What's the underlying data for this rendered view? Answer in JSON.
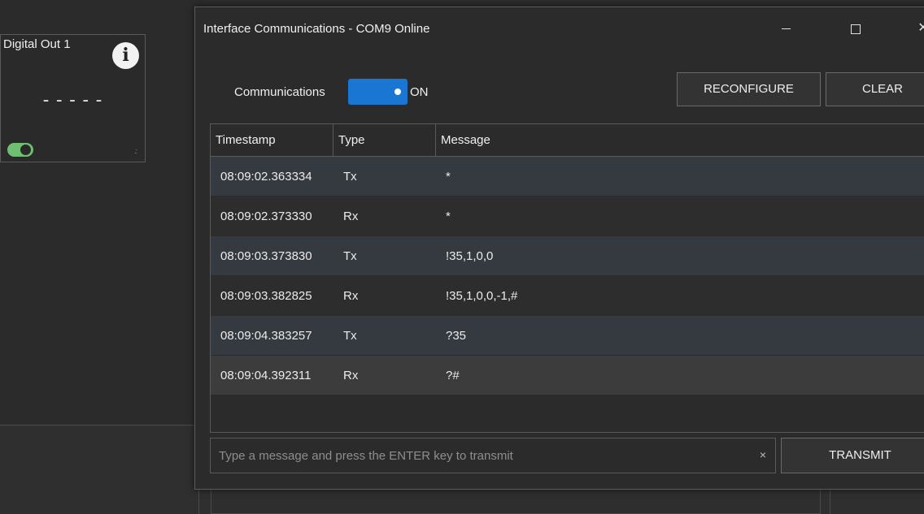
{
  "tile": {
    "title": "Digital Out 1",
    "info_glyph": "i",
    "value": "-----",
    "toggle_state": "on",
    "resize_glyph": ".:"
  },
  "dialog": {
    "title": "Interface Communications - COM9 Online",
    "window_controls": {
      "close": "✕"
    },
    "communications_label": "Communications",
    "communications_state": "ON",
    "reconfigure_label": "RECONFIGURE",
    "clear_label": "CLEAR",
    "table": {
      "columns": [
        "Timestamp",
        "Type",
        "Message"
      ],
      "rows": [
        {
          "timestamp": "08:09:02.363334",
          "type": "Tx",
          "message": "*"
        },
        {
          "timestamp": "08:09:02.373330",
          "type": "Rx",
          "message": "*"
        },
        {
          "timestamp": "08:09:03.373830",
          "type": "Tx",
          "message": "!35,1,0,0"
        },
        {
          "timestamp": "08:09:03.382825",
          "type": "Rx",
          "message": "!35,1,0,0,-1,#"
        },
        {
          "timestamp": "08:09:04.383257",
          "type": "Tx",
          "message": "?35"
        },
        {
          "timestamp": "08:09:04.392311",
          "type": "Rx",
          "message": "?#"
        }
      ]
    },
    "input": {
      "value": "",
      "placeholder": "Type a message and press the ENTER key to transmit",
      "clear_glyph": "×"
    },
    "transmit_label": "TRANSMIT"
  },
  "colors": {
    "accent": "#1976d2",
    "toggle_on": "#6fbf73",
    "background": "#2b2b2b"
  }
}
